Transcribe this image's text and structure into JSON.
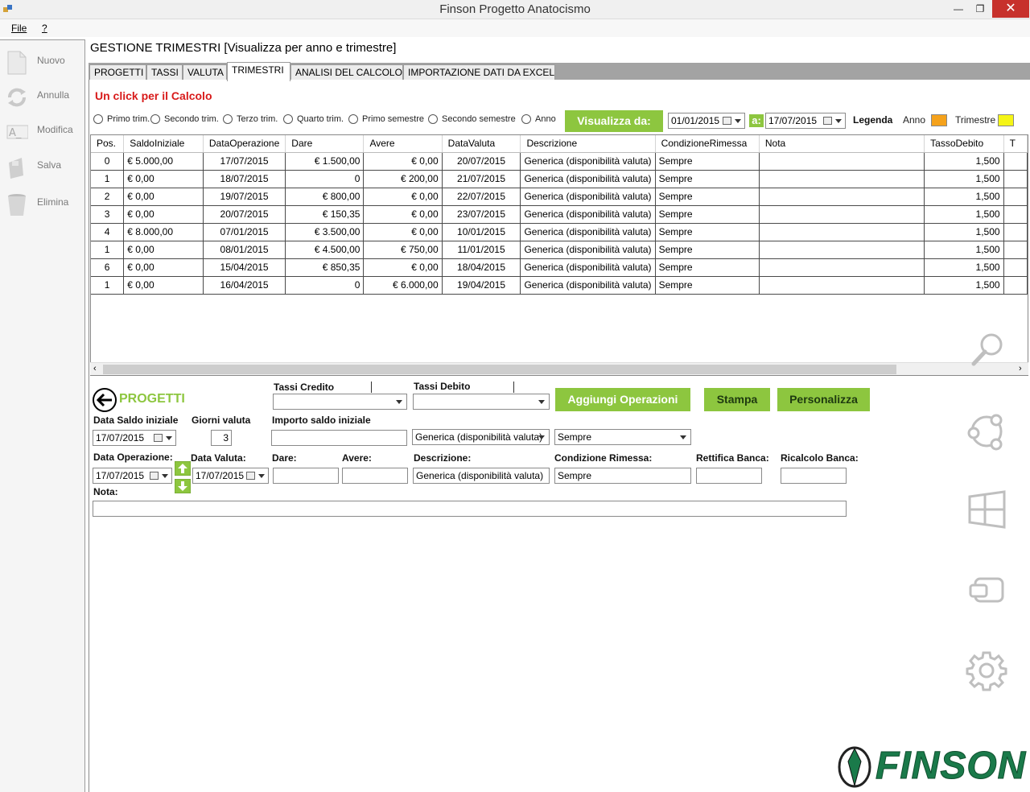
{
  "window": {
    "title": "Finson Progetto Anatocismo"
  },
  "menu": {
    "file": "File",
    "help": "?"
  },
  "toolbar": {
    "nuovo": "Nuovo",
    "annulla": "Annulla",
    "modifica": "Modifica",
    "salva": "Salva",
    "elimina": "Elimina"
  },
  "page_title": "GESTIONE TRIMESTRI [Visualizza per anno e trimestre]",
  "tabs": [
    "PROGETTI",
    "TASSI",
    "VALUTA",
    "TRIMESTRI",
    "ANALISI DEL CALCOLO",
    "IMPORTAZIONE DATI DA EXCEL"
  ],
  "calc_link": "Un click per il Calcolo",
  "filters": {
    "radios": [
      "Primo trim.",
      "Secondo trim.",
      "Terzo trim.",
      "Quarto trim.",
      "Primo semestre",
      "Secondo semestre",
      "Anno"
    ],
    "visualizza_label": "Visualizza da:",
    "date_from": "01/01/2015",
    "a_label": "a:",
    "date_to": "17/07/2015",
    "legenda": "Legenda",
    "anno": "Anno",
    "trimestre": "Trimestre",
    "anno_color": "#f5a21b",
    "trimestre_color": "#f5f516"
  },
  "grid": {
    "columns": [
      "Pos.",
      "SaldoIniziale",
      "DataOperazione",
      "Dare",
      "Avere",
      "DataValuta",
      "Descrizione",
      "CondizioneRimessa",
      "Nota",
      "TassoDebito",
      "T"
    ],
    "rows": [
      [
        "0",
        "€ 5.000,00",
        "17/07/2015",
        "€ 1.500,00",
        "€ 0,00",
        "20/07/2015",
        "Generica (disponibilità valuta)",
        "Sempre",
        "",
        "1,500"
      ],
      [
        "1",
        "€ 0,00",
        "18/07/2015",
        "0",
        "€ 200,00",
        "21/07/2015",
        "Generica (disponibilità valuta)",
        "Sempre",
        "",
        "1,500"
      ],
      [
        "2",
        "€ 0,00",
        "19/07/2015",
        "€ 800,00",
        "€ 0,00",
        "22/07/2015",
        "Generica (disponibilità valuta)",
        "Sempre",
        "",
        "1,500"
      ],
      [
        "3",
        "€ 0,00",
        "20/07/2015",
        "€ 150,35",
        "€ 0,00",
        "23/07/2015",
        "Generica (disponibilità valuta)",
        "Sempre",
        "",
        "1,500"
      ],
      [
        "4",
        "€ 8.000,00",
        "07/01/2015",
        "€ 3.500,00",
        "€ 0,00",
        "10/01/2015",
        "Generica (disponibilità valuta)",
        "Sempre",
        "",
        "1,500"
      ],
      [
        "1",
        "€ 0,00",
        "08/01/2015",
        "€ 4.500,00",
        "€ 750,00",
        "11/01/2015",
        "Generica (disponibilità valuta)",
        "Sempre",
        "",
        "1,500"
      ],
      [
        "6",
        "€ 0,00",
        "15/04/2015",
        "€ 850,35",
        "€ 0,00",
        "18/04/2015",
        "Generica (disponibilità valuta)",
        "Sempre",
        "",
        "1,500"
      ],
      [
        "1",
        "€ 0,00",
        "16/04/2015",
        "0",
        "€ 6.000,00",
        "19/04/2015",
        "Generica (disponibilità valuta)",
        "Sempre",
        "",
        "1,500"
      ]
    ]
  },
  "form": {
    "progetti_label": "PROGETTI",
    "tassi_credito": "Tassi Credito",
    "tassi_debito": "Tassi Debito",
    "aggiungi": "Aggiungi Operazioni",
    "stampa": "Stampa",
    "personalizza": "Personalizza",
    "data_saldo_label": "Data Saldo iniziale",
    "giorni_valuta_label": "Giorni valuta",
    "importo_label": "Importo saldo iniziale",
    "data_saldo": "17/07/2015",
    "giorni_valuta": "3",
    "descr_top": "Generica (disponibilità valuta)",
    "cond_top": "Sempre",
    "data_operazione_label": "Data Operazione:",
    "data_valuta_label": "Data Valuta:",
    "dare_label": "Dare:",
    "avere_label": "Avere:",
    "descrizione_label": "Descrizione:",
    "condizione_label": "Condizione Rimessa:",
    "rettifica_label": "Rettifica Banca:",
    "ricalcolo_label": "Ricalcolo Banca:",
    "data_operazione": "17/07/2015",
    "data_valuta": "17/07/2015",
    "descrizione": "Generica (disponibilità valuta)",
    "condizione": "Sempre",
    "nota_label": "Nota:"
  },
  "brand": {
    "logo_text": "FINSON",
    "logo_color": "#1a7a4a"
  }
}
